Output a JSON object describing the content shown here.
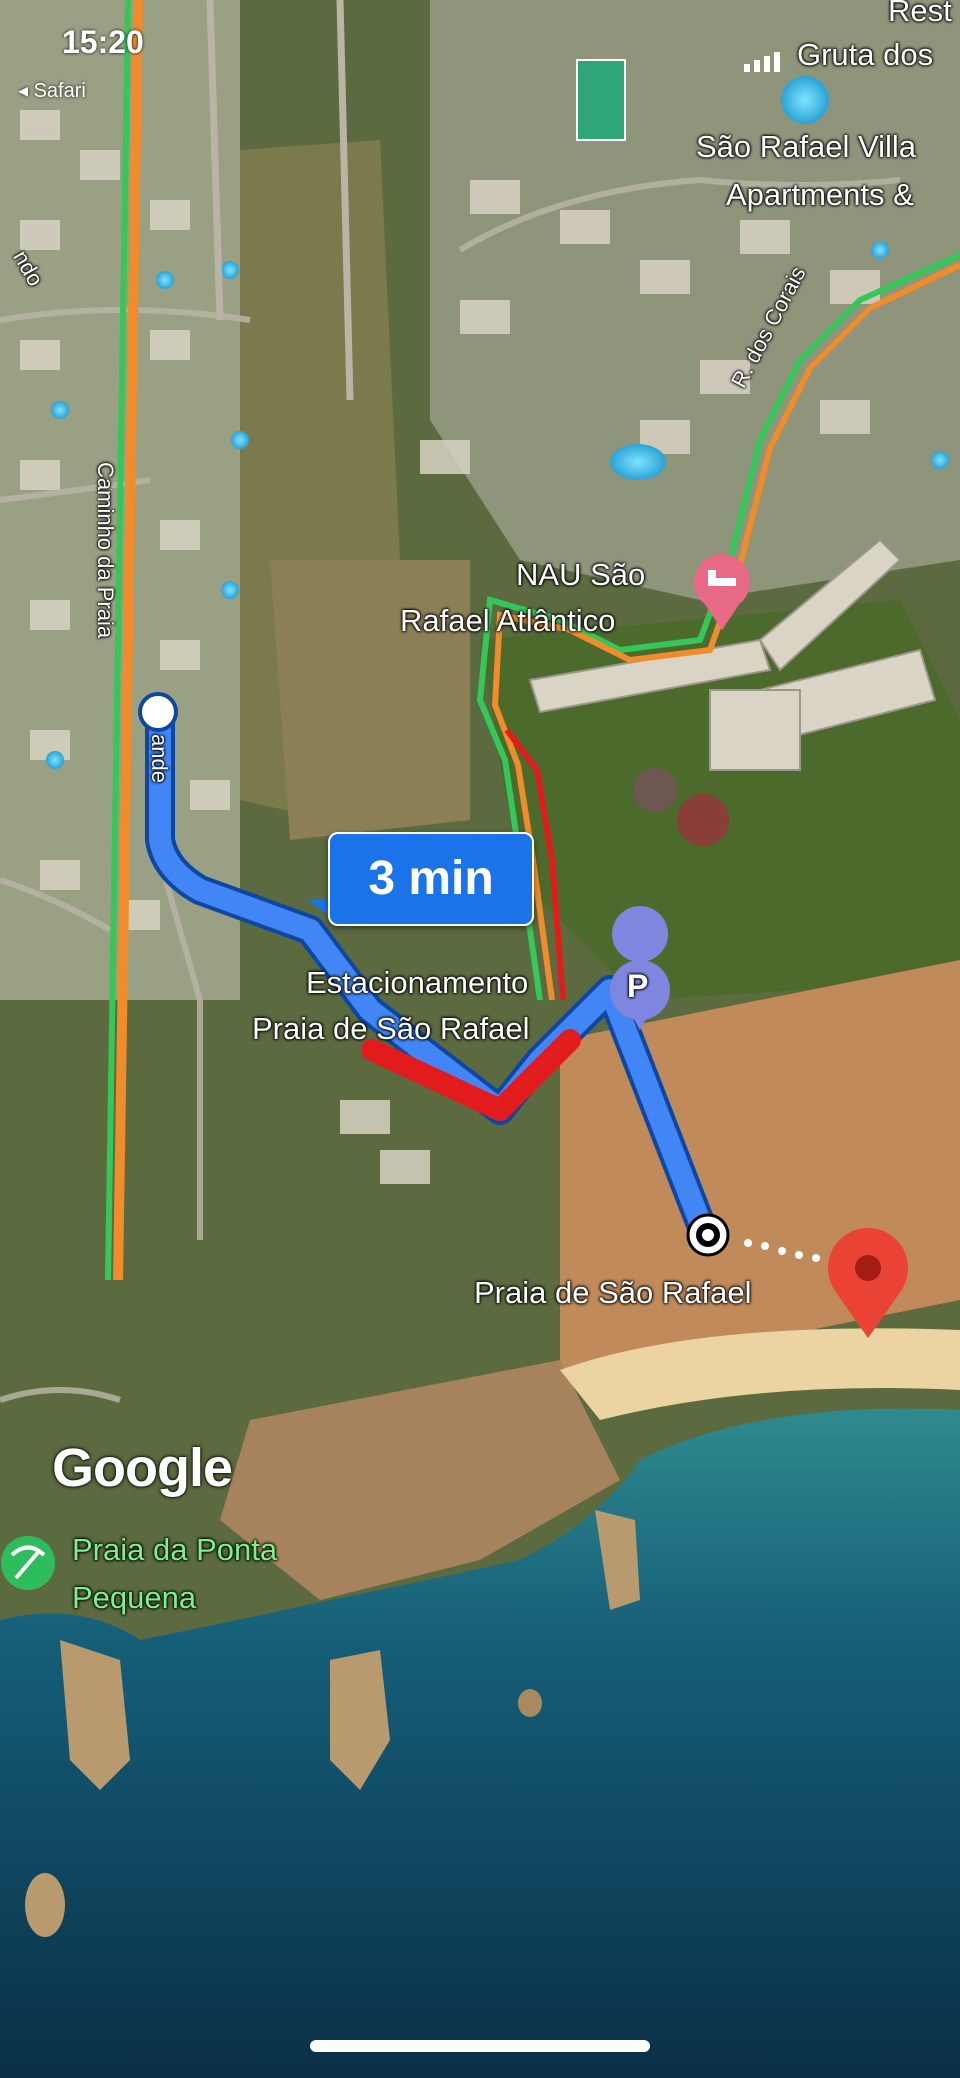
{
  "status_bar": {
    "time": "15:20",
    "back_app": "◂ Safari"
  },
  "map": {
    "labels": {
      "top_right_1": "Rest",
      "top_right_2": "Gruta dos",
      "villa": "São Rafael Villa",
      "villa_2": "Apartments &",
      "road_corais": "R. dos Corais",
      "road_caminho": "Caminho da Praia",
      "road_caminho_end": "ande",
      "road_left_edge": "ndo",
      "hotel_1": "NAU São",
      "hotel_2": "Rafael Atlântico",
      "parking_1": "Estacionamento",
      "parking_2": "Praia de São Rafael",
      "beach": "Praia de São Rafael",
      "ponta_1": "Praia da Ponta",
      "ponta_2": "Pequena",
      "google": "Google"
    },
    "eta": "3 min",
    "parking_symbol": "P",
    "colors": {
      "route": "#1a73e8",
      "traffic_red": "#e21c1c",
      "traffic_orange": "#f08c2c",
      "traffic_green": "#34c759",
      "pin": "#ea4335",
      "sea": "#0f4c68"
    }
  }
}
